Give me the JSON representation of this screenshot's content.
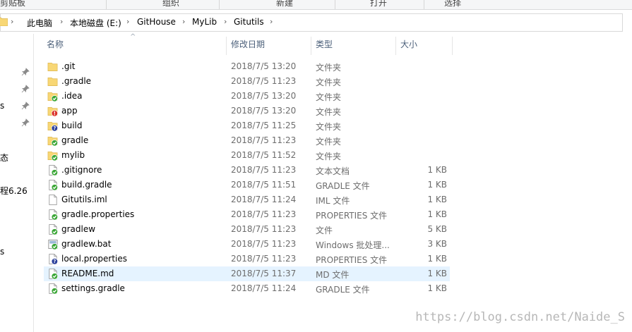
{
  "ribbon": {
    "groups": [
      "剪贴板",
      "组织",
      "新建",
      "打开",
      "选择"
    ]
  },
  "breadcrumb": [
    "此电脑",
    "本地磁盘 (E:)",
    "GitHouse",
    "MyLib",
    "Gitutils"
  ],
  "nav": {
    "items": [
      "s",
      "态",
      "程6.26",
      "s"
    ]
  },
  "columns": {
    "name": "名称",
    "date": "修改日期",
    "type": "类型",
    "size": "大小"
  },
  "files": [
    {
      "name": ".git",
      "date": "2018/7/5 13:20",
      "type": "文件夹",
      "size": "",
      "icon": "folder-icon"
    },
    {
      "name": ".gradle",
      "date": "2018/7/5 11:23",
      "type": "文件夹",
      "size": "",
      "icon": "folder-icon"
    },
    {
      "name": ".idea",
      "date": "2018/7/5 13:20",
      "type": "文件夹",
      "size": "",
      "icon": "folder-ok-icon"
    },
    {
      "name": "app",
      "date": "2018/7/5 13:20",
      "type": "文件夹",
      "size": "",
      "icon": "folder-conflict-icon"
    },
    {
      "name": "build",
      "date": "2018/7/5 11:25",
      "type": "文件夹",
      "size": "",
      "icon": "folder-unversioned-icon"
    },
    {
      "name": "gradle",
      "date": "2018/7/5 11:23",
      "type": "文件夹",
      "size": "",
      "icon": "folder-ok-icon"
    },
    {
      "name": "mylib",
      "date": "2018/7/5 11:52",
      "type": "文件夹",
      "size": "",
      "icon": "folder-ok-icon"
    },
    {
      "name": ".gitignore",
      "date": "2018/7/5 11:23",
      "type": "文本文档",
      "size": "1 KB",
      "icon": "file-ok-icon"
    },
    {
      "name": "build.gradle",
      "date": "2018/7/5 11:51",
      "type": "GRADLE 文件",
      "size": "1 KB",
      "icon": "file-ok-icon"
    },
    {
      "name": "Gitutils.iml",
      "date": "2018/7/5 11:24",
      "type": "IML 文件",
      "size": "1 KB",
      "icon": "file-icon"
    },
    {
      "name": "gradle.properties",
      "date": "2018/7/5 11:23",
      "type": "PROPERTIES 文件",
      "size": "1 KB",
      "icon": "file-ok-icon"
    },
    {
      "name": "gradlew",
      "date": "2018/7/5 11:23",
      "type": "文件",
      "size": "5 KB",
      "icon": "file-ok-icon"
    },
    {
      "name": "gradlew.bat",
      "date": "2018/7/5 11:23",
      "type": "Windows 批处理...",
      "size": "3 KB",
      "icon": "batch-ok-icon"
    },
    {
      "name": "local.properties",
      "date": "2018/7/5 11:23",
      "type": "PROPERTIES 文件",
      "size": "1 KB",
      "icon": "file-unversioned-icon"
    },
    {
      "name": "README.md",
      "date": "2018/7/5 11:37",
      "type": "MD 文件",
      "size": "1 KB",
      "icon": "file-ok-icon"
    },
    {
      "name": "settings.gradle",
      "date": "2018/7/5 11:24",
      "type": "GRADLE 文件",
      "size": "1 KB",
      "icon": "file-ok-icon"
    }
  ],
  "watermark": "https://blog.csdn.net/Naide_S",
  "colors": {
    "folder": "#f8d775",
    "ok_badge": "#3aa636",
    "conflict_badge": "#d9322a",
    "unversioned_badge": "#2a3f9a",
    "selected_row": "#e5f3ff"
  }
}
